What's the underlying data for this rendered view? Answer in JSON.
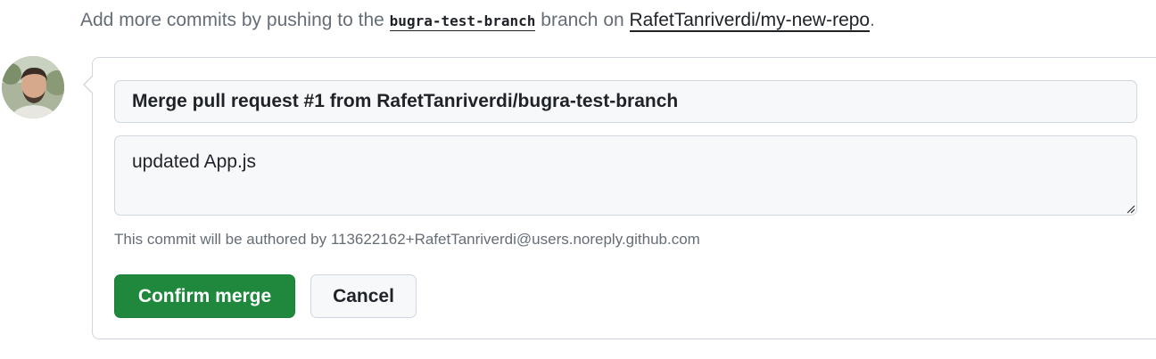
{
  "hint": {
    "prefix": "Add more commits by pushing to the ",
    "branch": "bugra-test-branch",
    "middle": " branch on ",
    "repo": "RafetTanriverdi/my-new-repo",
    "suffix": "."
  },
  "merge": {
    "title_value": "Merge pull request #1 from RafetTanriverdi/bugra-test-branch",
    "body_value": "updated App.js",
    "author_note": "This commit will be authored by 113622162+RafetTanriverdi@users.noreply.github.com",
    "confirm_label": "Confirm merge",
    "cancel_label": "Cancel"
  },
  "colors": {
    "confirm_button": "#1f883d",
    "muted_text": "#656d76",
    "border": "#d0d7de",
    "input_background": "#f6f8fa"
  }
}
